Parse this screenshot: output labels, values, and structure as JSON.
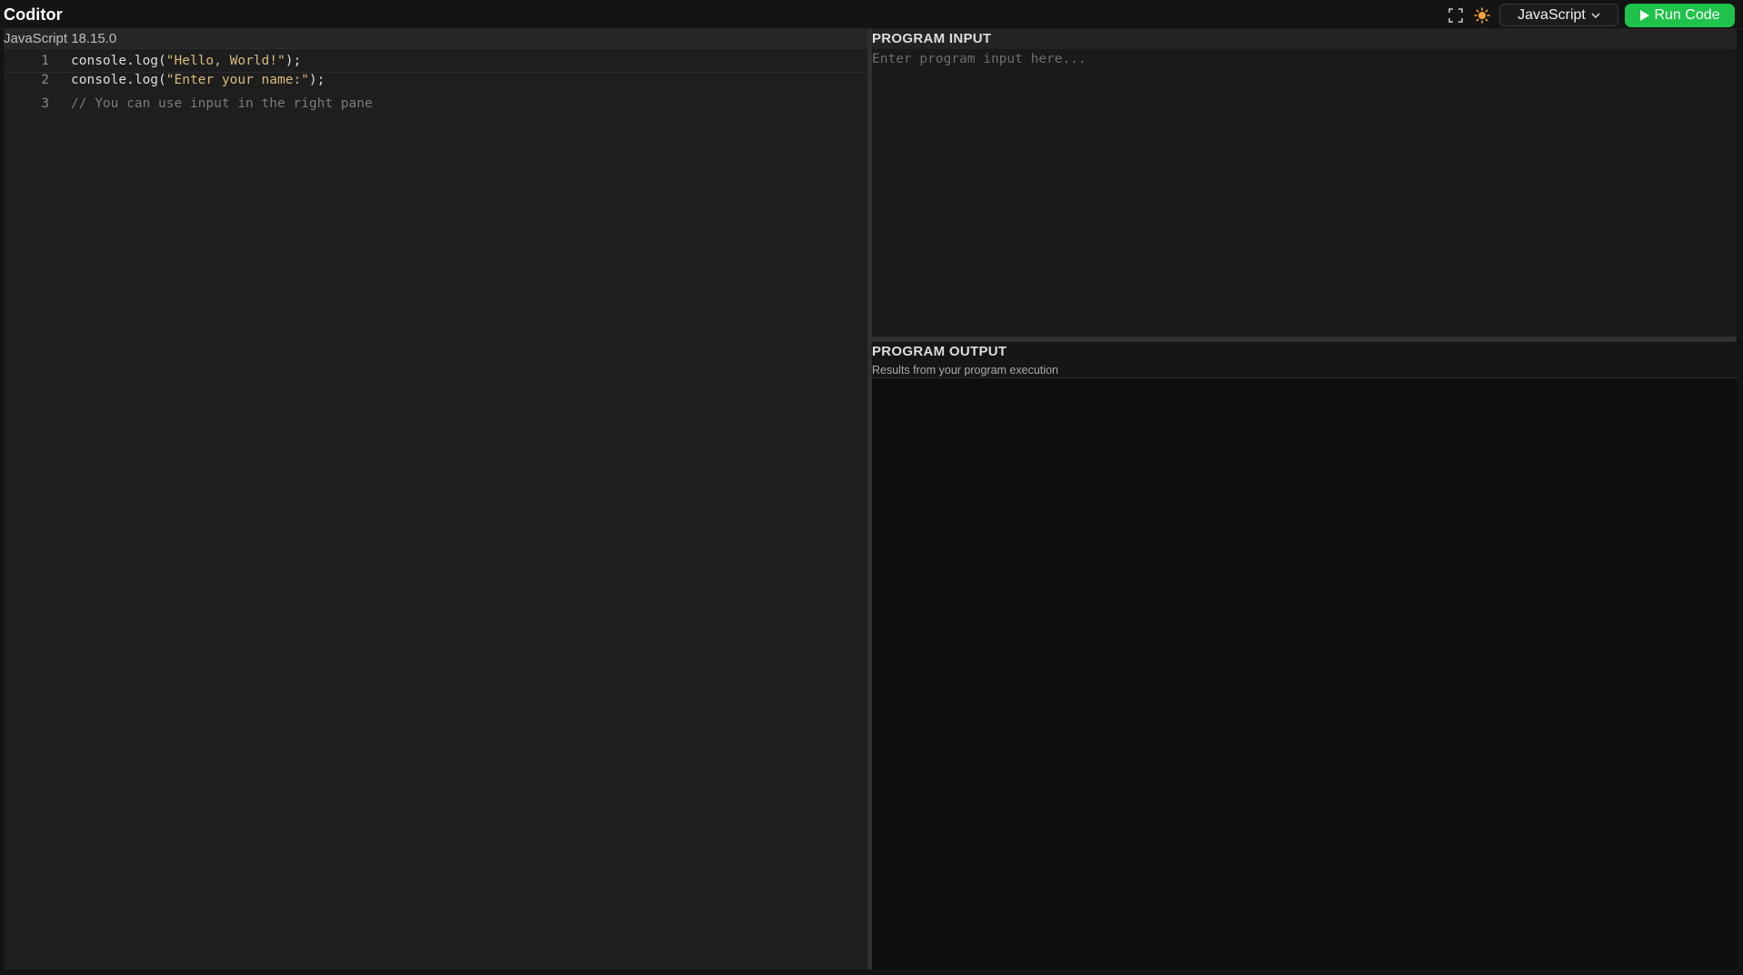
{
  "app": {
    "title": "Coditor"
  },
  "toolbar": {
    "fullscreen_icon": "fullscreen-icon",
    "theme_icon": "sun-icon",
    "language": "JavaScript",
    "run_label": "Run Code",
    "run_color": "#1fc24a"
  },
  "editor": {
    "language_version": "JavaScript 18.15.0",
    "lines": [
      {
        "number": "1",
        "text": "console.log(\"Hello, World!\");"
      },
      {
        "number": "2",
        "text": "console.log(\"Enter your name:\");"
      },
      {
        "number": "3",
        "text": "// You can use input in the right pane"
      }
    ],
    "string_color": "#d7ba7d",
    "comment_color": "#7a7a7a"
  },
  "input": {
    "title": "PROGRAM INPUT",
    "placeholder": "Enter program input here..."
  },
  "output": {
    "title": "PROGRAM OUTPUT",
    "subtitle": "Results from your program execution"
  }
}
